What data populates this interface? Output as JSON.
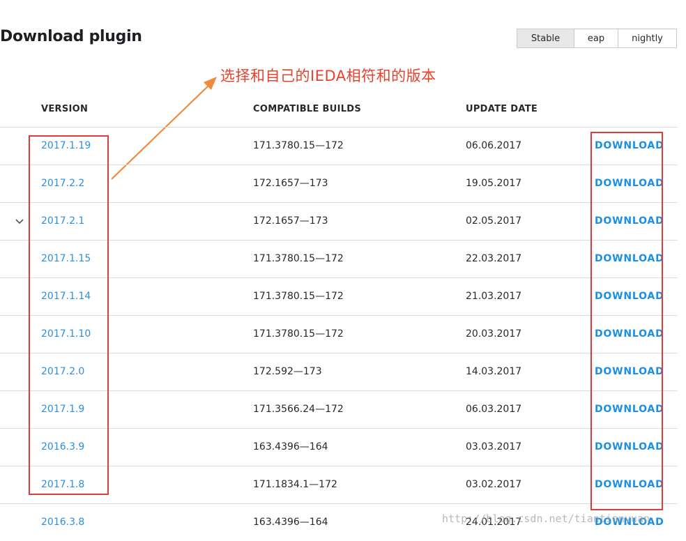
{
  "page": {
    "title": "Download plugin",
    "annotation": "选择和自己的IEDA相符和的版本",
    "watermark": "http://blog.csdn.net/tiantianyuan"
  },
  "channels": [
    {
      "label": "Stable",
      "active": true
    },
    {
      "label": "eap",
      "active": false
    },
    {
      "label": "nightly",
      "active": false
    }
  ],
  "table": {
    "headers": {
      "version": "VERSION",
      "builds": "COMPATIBLE BUILDS",
      "date": "UPDATE DATE"
    },
    "rows": [
      {
        "version": "2017.1.19",
        "builds": "171.3780.15—172",
        "date": "06.06.2017",
        "download": "DOWNLOAD"
      },
      {
        "version": "2017.2.2",
        "builds": "172.1657—173",
        "date": "19.05.2017",
        "download": "DOWNLOAD"
      },
      {
        "version": "2017.2.1",
        "builds": "172.1657—173",
        "date": "02.05.2017",
        "download": "DOWNLOAD",
        "expandable": true
      },
      {
        "version": "2017.1.15",
        "builds": "171.3780.15—172",
        "date": "22.03.2017",
        "download": "DOWNLOAD"
      },
      {
        "version": "2017.1.14",
        "builds": "171.3780.15—172",
        "date": "21.03.2017",
        "download": "DOWNLOAD"
      },
      {
        "version": "2017.1.10",
        "builds": "171.3780.15—172",
        "date": "20.03.2017",
        "download": "DOWNLOAD"
      },
      {
        "version": "2017.2.0",
        "builds": "172.592—173",
        "date": "14.03.2017",
        "download": "DOWNLOAD"
      },
      {
        "version": "2017.1.9",
        "builds": "171.3566.24—172",
        "date": "06.03.2017",
        "download": "DOWNLOAD"
      },
      {
        "version": "2016.3.9",
        "builds": "163.4396—164",
        "date": "03.03.2017",
        "download": "DOWNLOAD"
      },
      {
        "version": "2017.1.8",
        "builds": "171.1834.1—172",
        "date": "03.02.2017",
        "download": "DOWNLOAD"
      },
      {
        "version": "2016.3.8",
        "builds": "163.4396—164",
        "date": "24.01.2017",
        "download": "DOWNLOAD"
      }
    ]
  },
  "colors": {
    "link": "#2c8fe0",
    "annotation": "#e8412c",
    "arrow": "#f08a3c",
    "highlight_box": "#e03b3b"
  },
  "icons": {
    "expand": "chevron-down-icon"
  }
}
